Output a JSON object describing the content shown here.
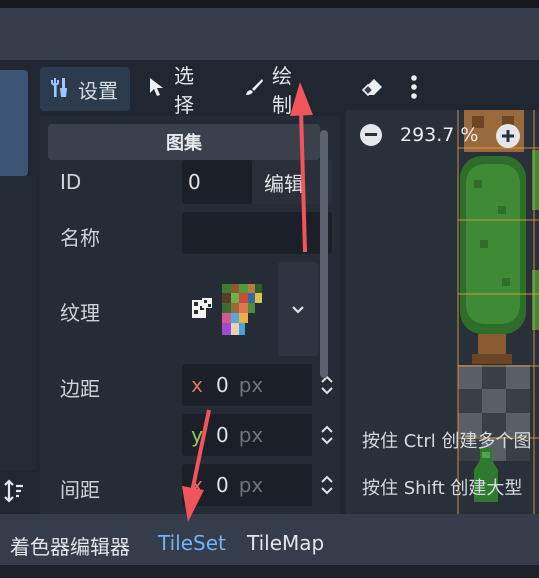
{
  "toolbar": {
    "setup_label": "设置",
    "select_label": "选择",
    "paint_label": "绘制"
  },
  "inspector": {
    "section_title": "图集",
    "id_label": "ID",
    "id_value": "0",
    "edit_label": "编辑",
    "name_label": "名称",
    "texture_label": "纹理",
    "margins_label": "边距",
    "separation_label": "间距",
    "margin_x_axis": "x",
    "margin_x_value": "0",
    "margin_y_axis": "y",
    "margin_y_value": "0",
    "sep_x_axis": "x",
    "sep_x_value": "0",
    "unit": "px"
  },
  "viewport": {
    "zoom_label": "293.7 %",
    "hint_ctrl": "按住 Ctrl 创建多个图",
    "hint_shift": "按住 Shift 创建大型"
  },
  "bottom_tabs": {
    "shader_editor": "着色器编辑器",
    "tileset": "TileSet",
    "tilemap": "TileMap"
  },
  "colors": {
    "accent": "#6fb3ff",
    "arrow": "#f2545b",
    "panel": "#262c36",
    "topbar": "#363d4a"
  }
}
